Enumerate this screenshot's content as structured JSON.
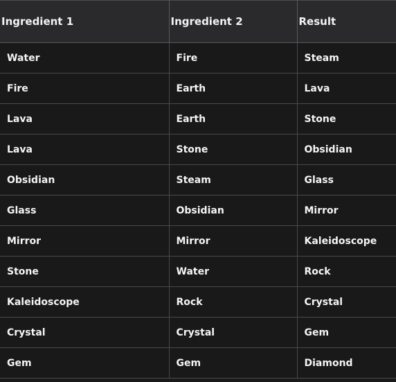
{
  "table": {
    "columns": [
      {
        "key": "ingredient_1",
        "label": "Ingredient 1"
      },
      {
        "key": "ingredient_2",
        "label": "Ingredient 2"
      },
      {
        "key": "result",
        "label": "Result"
      }
    ],
    "rows": [
      {
        "ingredient_1": "Water",
        "ingredient_2": "Fire",
        "result": "Steam"
      },
      {
        "ingredient_1": "Fire",
        "ingredient_2": "Earth",
        "result": "Lava"
      },
      {
        "ingredient_1": "Lava",
        "ingredient_2": "Earth",
        "result": "Stone"
      },
      {
        "ingredient_1": "Lava",
        "ingredient_2": "Stone",
        "result": "Obsidian"
      },
      {
        "ingredient_1": "Obsidian",
        "ingredient_2": "Steam",
        "result": "Glass"
      },
      {
        "ingredient_1": "Glass",
        "ingredient_2": "Obsidian",
        "result": "Mirror"
      },
      {
        "ingredient_1": "Mirror",
        "ingredient_2": "Mirror",
        "result": "Kaleidoscope"
      },
      {
        "ingredient_1": "Stone",
        "ingredient_2": "Water",
        "result": "Rock"
      },
      {
        "ingredient_1": "Kaleidoscope",
        "ingredient_2": "Rock",
        "result": "Crystal"
      },
      {
        "ingredient_1": "Crystal",
        "ingredient_2": "Crystal",
        "result": "Gem"
      },
      {
        "ingredient_1": "Gem",
        "ingredient_2": "Gem",
        "result": "Diamond"
      }
    ]
  },
  "colors": {
    "page_background": "#1a1a1a",
    "header_background": "#2a2a2c",
    "row_background": "#191919",
    "border": "#4a4a4a",
    "header_border": "#5a5a5a",
    "text": "#f5f5f5"
  }
}
